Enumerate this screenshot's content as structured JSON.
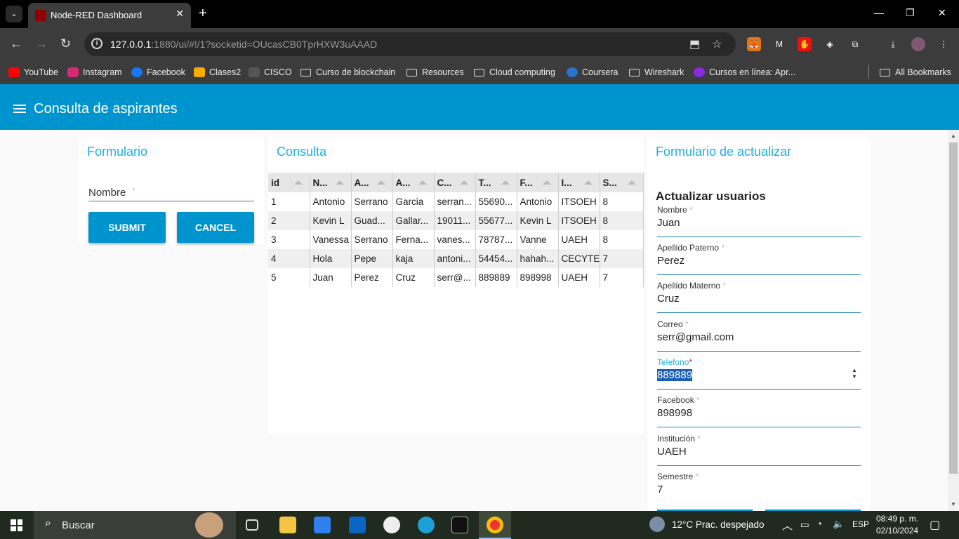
{
  "browser": {
    "tab_title": "Node-RED Dashboard",
    "url_host": "127.0.0.1",
    "url_rest": ":1880/ui/#!/1?socketid=OUcasCB0TprHXW3uAAAD",
    "bookmarks": [
      "YouTube",
      "Instagram",
      "Facebook",
      "Clases2",
      "CISCO",
      "Curso de blockchain",
      "Resources",
      "Cloud computing",
      "Coursera",
      "Wireshark",
      "Cursos en línea: Apr...",
      "All Bookmarks"
    ]
  },
  "app": {
    "title": "Consulta de aspirantes"
  },
  "formulario": {
    "title": "Formulario",
    "nombre_label": "Nombre",
    "required_mark": "*",
    "submit_label": "SUBMIT",
    "cancel_label": "CANCEL"
  },
  "consulta": {
    "title": "Consulta",
    "columns": [
      "id",
      "N...",
      "A...",
      "A...",
      "C...",
      "T...",
      "F...",
      "I...",
      "S..."
    ],
    "rows": [
      [
        "1",
        "Antonio",
        "Serrano",
        "Garcia",
        "serran...",
        "55690...",
        "Antonio",
        "ITSOEH",
        "8"
      ],
      [
        "2",
        "Kevin L",
        "Guad...",
        "Gallar...",
        "19011...",
        "55677...",
        "Kevin L",
        "ITSOEH",
        "8"
      ],
      [
        "3",
        "Vanessa",
        "Serrano",
        "Ferna...",
        "vanes...",
        "78787...",
        "Vanne",
        "UAEH",
        "8"
      ],
      [
        "4",
        "Hola",
        "Pepe",
        "kaja",
        "antoni...",
        "54454...",
        "hahah...",
        "CECYTE",
        "7"
      ],
      [
        "5",
        "Juan",
        "Perez",
        "Cruz",
        "serr@...",
        "889889",
        "898998",
        "UAEH",
        "7"
      ]
    ]
  },
  "actualizar": {
    "title": "Formulario de actualizar",
    "subtitle": "Actualizar usuarios",
    "fields": [
      {
        "label": "Nombre",
        "value": "Juan"
      },
      {
        "label": "Apellido Paterno",
        "value": "Perez"
      },
      {
        "label": "Apellido Materno",
        "value": "Cruz"
      },
      {
        "label": "Correo",
        "value": "serr@gmail.com"
      },
      {
        "label": "Telefono",
        "value": "889889"
      },
      {
        "label": "Facebook",
        "value": "898998"
      },
      {
        "label": "Institución",
        "value": "UAEH"
      },
      {
        "label": "Semestre",
        "value": "7"
      }
    ]
  },
  "taskbar": {
    "search_text": "Buscar",
    "weather": "12°C  Prac. despejado",
    "language": "ESP",
    "time": "08:49 p. m.",
    "date": "02/10/2024"
  }
}
